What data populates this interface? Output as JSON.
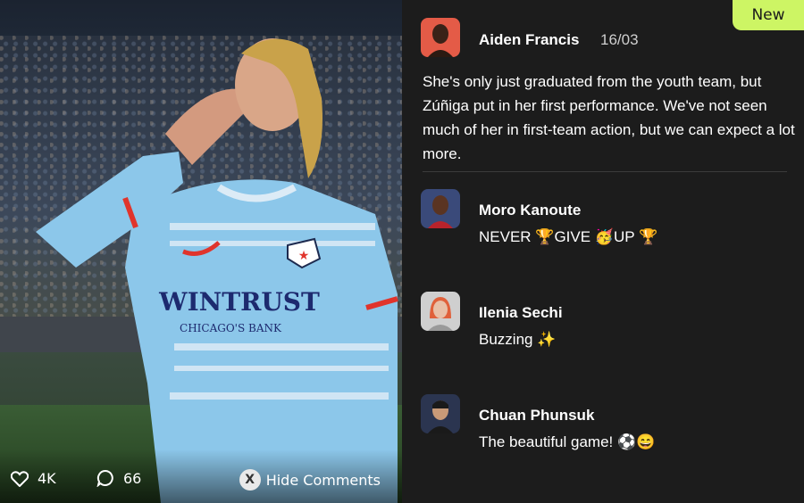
{
  "media": {
    "likes": "4K",
    "comments": "66",
    "hide_button_glyph": "X",
    "hide_label": "Hide Comments",
    "sponsor_text": "WINTRUST",
    "sponsor_sub": "CHICAGO'S BANK"
  },
  "panel": {
    "badge": "New",
    "post": {
      "author": "Aiden Francis",
      "date": "16/03",
      "text": "She's only just graduated from the youth team, but Zúñiga put in her first performance. We've not seen much of her in first-team action, but we can expect a lot more."
    },
    "comments": [
      {
        "author": "Moro Kanoute",
        "text": "NEVER 🏆GIVE 🥳UP 🏆"
      },
      {
        "author": "Ilenia Sechi",
        "text": "Buzzing ✨"
      },
      {
        "author": "Chuan Phunsuk",
        "text": "The beautiful game! ⚽😄"
      }
    ]
  },
  "colors": {
    "accent": "#cdf564",
    "panel_bg": "#1c1c1c",
    "kit_blue": "#8cc7ea",
    "kit_red": "#e0342c"
  }
}
